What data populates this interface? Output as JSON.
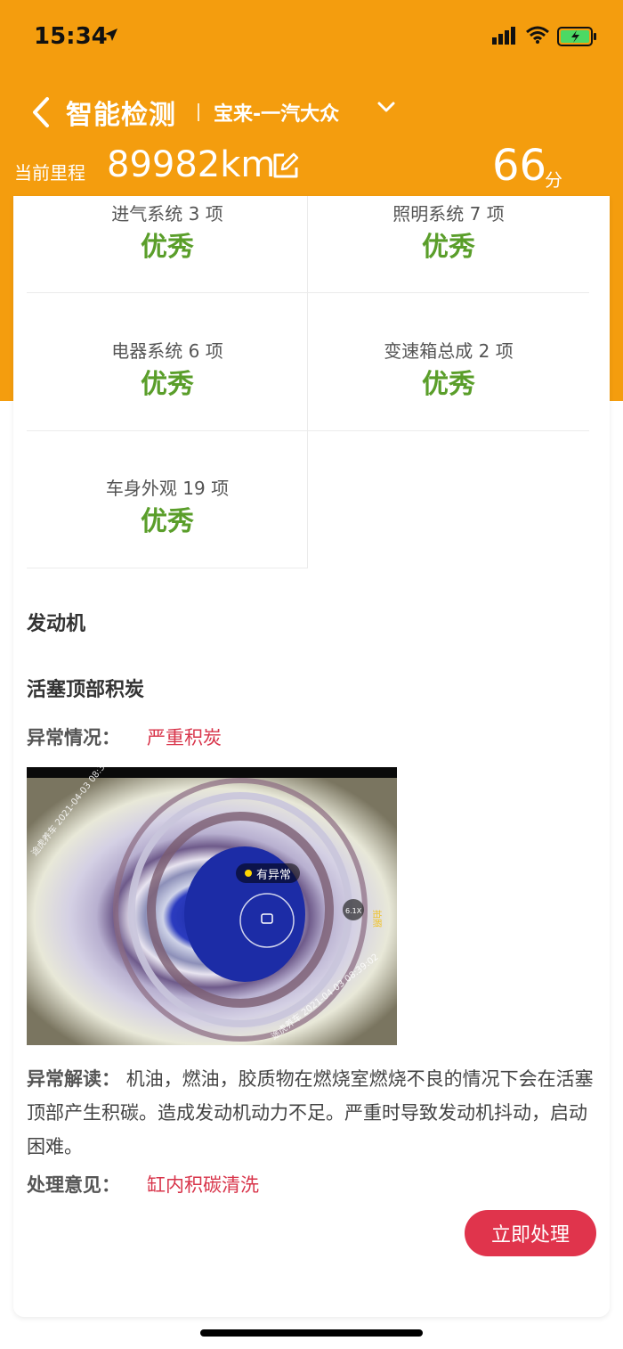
{
  "status_bar": {
    "time": "15:34"
  },
  "header": {
    "title": "智能检测",
    "car": "宝来-一汽大众",
    "mileage_label": "当前里程",
    "mileage_value": "89982km",
    "score": "66",
    "score_unit": "分"
  },
  "grid": [
    {
      "label": "进气系统 3 项",
      "grade": "优秀"
    },
    {
      "label": "照明系统 7 项",
      "grade": "优秀"
    },
    {
      "label": "电器系统 6 项",
      "grade": "优秀"
    },
    {
      "label": "变速箱总成 2 项",
      "grade": "优秀"
    },
    {
      "label": "车身外观 19 项",
      "grade": "优秀"
    }
  ],
  "issue": {
    "section": "发动机",
    "title": "活塞顶部积炭",
    "abnormal_label": "异常情况：",
    "abnormal_value": "严重积炭",
    "photo_tag": "有异常",
    "photo_zoom": "6.1X",
    "photo_timestamp": "2021-04-03 08:39:02",
    "photo_brand": "途虎养车",
    "photo_side_text": "拍照",
    "interpret_label": "异常解读：",
    "interpret_text": "机油，燃油，胶质物在燃烧室燃烧不良的情况下会在活塞顶部产生积碳。造成发动机动力不足。严重时导致发动机抖动，启动困难。",
    "advice_label": "处理意见：",
    "advice_value": "缸内积碳清洗",
    "action_button": "立即处理"
  },
  "colors": {
    "brand_orange": "#f49d0e",
    "grade_green": "#5a9e2a",
    "alert_red": "#d8344a",
    "button_red": "#e0344c"
  }
}
